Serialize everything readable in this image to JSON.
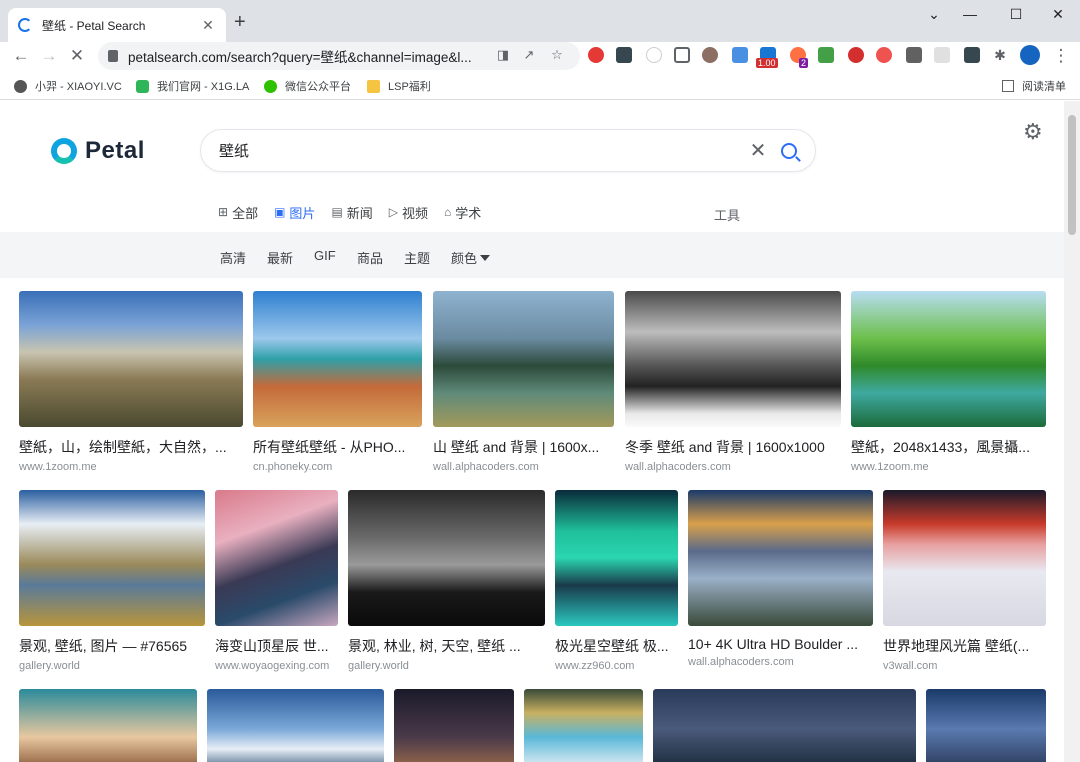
{
  "browser": {
    "tab_title": "Petal Search",
    "tab_title_prefix": "壁纸 - ",
    "url": "petalsearch.com/search?query=壁纸&channel=image&l...",
    "bookmarks": [
      {
        "label": "小羿 - XIAOYI.VC",
        "color": "#555"
      },
      {
        "label": "我们官网 - X1G.LA",
        "color": "#2fb55a"
      },
      {
        "label": "微信公众平台",
        "color": "#2dc100"
      },
      {
        "label": "LSP福利",
        "color": "#f5c542"
      }
    ],
    "reading_list": "阅读清单",
    "ext_badge_1": "1.00",
    "ext_badge_2": "2"
  },
  "page": {
    "logo_text": "Petal",
    "search_value": "壁纸",
    "tabs": [
      {
        "icon": "grid-icon",
        "glyph": "⊞",
        "label": "全部",
        "active": false
      },
      {
        "icon": "image-icon",
        "glyph": "▣",
        "label": "图片",
        "active": true
      },
      {
        "icon": "news-icon",
        "glyph": "▤",
        "label": "新闻",
        "active": false
      },
      {
        "icon": "video-icon",
        "glyph": "▷",
        "label": "视频",
        "active": false
      },
      {
        "icon": "academic-icon",
        "glyph": "⌂",
        "label": "学术",
        "active": false
      }
    ],
    "tools_label": "工具",
    "filters": [
      "高清",
      "最新",
      "GIF",
      "商品",
      "主题",
      "颜色"
    ],
    "results_row1": [
      {
        "title": "壁紙，山，绘制壁紙，大自然，...",
        "source": "www.1zoom.me"
      },
      {
        "title": "所有壁纸壁纸 - 从PHO...",
        "source": "cn.phoneky.com"
      },
      {
        "title": "山 壁纸 and 背景 | 1600x...",
        "source": "wall.alphacoders.com"
      },
      {
        "title": "冬季 壁纸 and 背景 | 1600x1000",
        "source": "wall.alphacoders.com"
      },
      {
        "title": "壁紙，2048x1433，風景攝...",
        "source": "www.1zoom.me"
      }
    ],
    "results_row2": [
      {
        "title": "景观, 壁纸, 图片 — #76565",
        "source": "gallery.world"
      },
      {
        "title": "海变山顶星辰 世...",
        "source": "www.woyaogexing.com"
      },
      {
        "title": "景观, 林业, 树, 天空, 壁纸 ...",
        "source": "gallery.world"
      },
      {
        "title": "极光星空壁纸 极...",
        "source": "www.zz960.com"
      },
      {
        "title": "10+ 4K Ultra HD Boulder ...",
        "source": "wall.alphacoders.com"
      },
      {
        "title": "世界地理风光篇 壁纸(...",
        "source": "v3wall.com"
      }
    ]
  }
}
